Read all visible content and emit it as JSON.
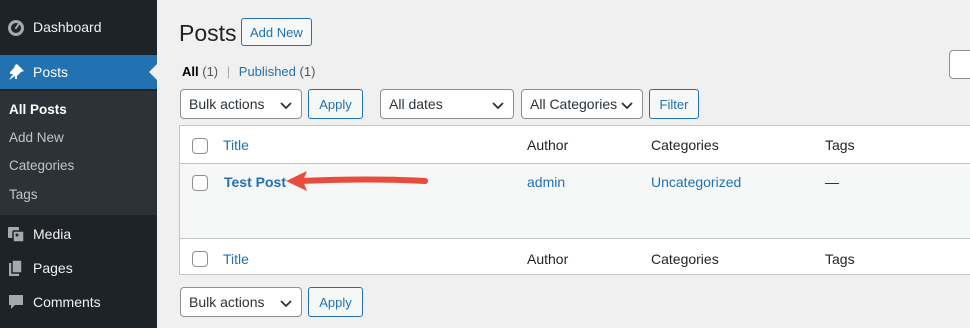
{
  "sidebar": {
    "items": [
      {
        "label": "Dashboard",
        "icon": "dashboard-icon"
      },
      {
        "label": "Posts",
        "icon": "pin-icon",
        "active": true
      },
      {
        "label": "Media",
        "icon": "media-icon"
      },
      {
        "label": "Pages",
        "icon": "pages-icon"
      },
      {
        "label": "Comments",
        "icon": "comments-icon"
      }
    ],
    "submenu": [
      "All Posts",
      "Add New",
      "Categories",
      "Tags"
    ]
  },
  "header": {
    "title": "Posts",
    "add_new": "Add New"
  },
  "views": {
    "all_label": "All",
    "all_count": "(1)",
    "separator": "|",
    "published_label": "Published",
    "published_count": "(1)"
  },
  "filters": {
    "bulk_actions": "Bulk actions",
    "apply": "Apply",
    "dates": "All dates",
    "categories": "All Categories",
    "filter": "Filter"
  },
  "table": {
    "columns": [
      "Title",
      "Author",
      "Categories",
      "Tags"
    ],
    "rows": [
      {
        "title": "Test Post",
        "author": "admin",
        "categories": "Uncategorized",
        "tags": "—"
      }
    ]
  },
  "bottom": {
    "bulk_actions": "Bulk actions",
    "apply": "Apply"
  },
  "colors": {
    "accent": "#2271b1",
    "sidebar_bg": "#1d2327",
    "arrow": "#e74c3c"
  }
}
